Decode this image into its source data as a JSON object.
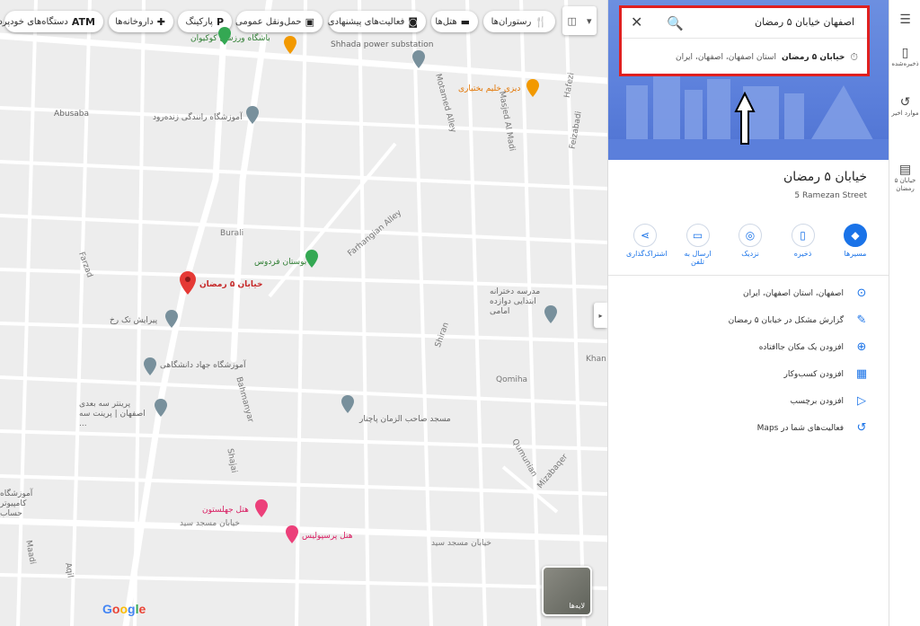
{
  "chips": [
    {
      "label": "دستگاه‌های خودپرداز",
      "icon": "atm-icon",
      "glyph": "ATM"
    },
    {
      "label": "داروخانه‌ها",
      "icon": "pharmacy-icon",
      "glyph": "✚"
    },
    {
      "label": "پارکینگ",
      "icon": "parking-icon",
      "glyph": "P"
    },
    {
      "label": "حمل‌ونقل عمومی",
      "icon": "transit-icon",
      "glyph": "▣"
    },
    {
      "label": "فعالیت‌های پیشنهادی",
      "icon": "camera-icon",
      "glyph": "◙"
    },
    {
      "label": "هتل‌ها",
      "icon": "hotel-icon",
      "glyph": "▬"
    },
    {
      "label": "رستوران‌ها",
      "icon": "restaurant-icon",
      "glyph": "🍴"
    }
  ],
  "map": {
    "labels": {
      "stadium": "باشگاه ورزشی کوکیوان",
      "substation": "Shhada power substation",
      "restaurant": "دیزی خلیم بختیاری",
      "abusaba": "Abusaba",
      "driving_school": "آموزشگاه رانندگی زنده‌رود",
      "motamed": "Motamed Alley",
      "masjed": "Masjed Al Madi",
      "hafezi": "Hafezi",
      "feizabadi": "Feizabadi",
      "fathangian": "Farhangian Alley",
      "burali": "Burali",
      "farzad": "Farzad",
      "park": "بوستان فردوس",
      "selected": "خیابان ۵ رمضان",
      "school": "مدرسه دخترانه ابتدایی دوازده امامی",
      "beauty": "پیرایش تک رخ",
      "university": "آموزشگاه جهاد دانشگاهی",
      "shiran": "Shiran",
      "khan": "Khan",
      "qomiha": "Qomiha",
      "bahmanyar": "Bahmanyar",
      "shajai": "Shajai",
      "mosque": "مسجد صاحب الزمان پاچنار",
      "print": "پرینتر سه بعدی اصفهان | پرینت سه ...",
      "qumunian": "Qumunian",
      "mizabaqer": "Mizabaqer",
      "computer": "آموزشگاه کامپیوتر حساب",
      "hotel1": "هتل جهلستون",
      "hotel2": "هتل پرسپولیس",
      "street1": "خیابان مسجد سید",
      "street2": "خیابان مسجد سید",
      "maadi": "Maadi",
      "aqil": "Aqil",
      "google": "Google",
      "layers": "لایه‌ها"
    }
  },
  "search": {
    "query": "اصفهان خیابان ۵ رمضان",
    "suggestion_bold": "خیابان ۵ رمضان",
    "suggestion_rest": "استان اصفهان، اصفهان، ایران"
  },
  "place": {
    "title": "خیابان ۵ رمضان",
    "subtitle": "5 Ramezan Street"
  },
  "actions": [
    {
      "label": "مسیرها",
      "icon": "directions-icon",
      "glyph": "◆",
      "primary": true
    },
    {
      "label": "ذخیره",
      "icon": "bookmark-icon",
      "glyph": "▯"
    },
    {
      "label": "نزدیک",
      "icon": "nearby-icon",
      "glyph": "◎"
    },
    {
      "label": "ارسال به تلفن",
      "icon": "send-to-phone-icon",
      "glyph": "▭"
    },
    {
      "label": "اشتراک‌گذاری",
      "icon": "share-icon",
      "glyph": "⋖"
    }
  ],
  "info_rows": [
    {
      "text": "اصفهان، استان اصفهان، ایران",
      "icon": "location-icon",
      "glyph": "⊙"
    },
    {
      "text": "گزارش مشکل در خیابان ۵ رمضان",
      "icon": "pencil-icon",
      "glyph": "✎"
    },
    {
      "text": "افزودن یک مکان جاافتاده",
      "icon": "add-place-icon",
      "glyph": "⊕"
    },
    {
      "text": "افزودن کسب‌وکار",
      "icon": "add-business-icon",
      "glyph": "▦"
    },
    {
      "text": "افزودن برچسب",
      "icon": "label-icon",
      "glyph": "▷"
    },
    {
      "text": "فعالیت‌های شما در Maps",
      "icon": "history-icon",
      "glyph": "↺"
    }
  ],
  "rail": [
    {
      "label": "ذخیره‌شده",
      "icon": "bookmark-icon",
      "glyph": "▯"
    },
    {
      "label": "موارد اخیر",
      "icon": "history-icon",
      "glyph": "↺"
    },
    {
      "label": "خیابان ۵ رمضان",
      "icon": "street-thumbnail-icon",
      "glyph": "▤"
    }
  ],
  "colors": {
    "accent": "#1a73e8",
    "highlight": "#e02020",
    "pin": "#e53935"
  }
}
